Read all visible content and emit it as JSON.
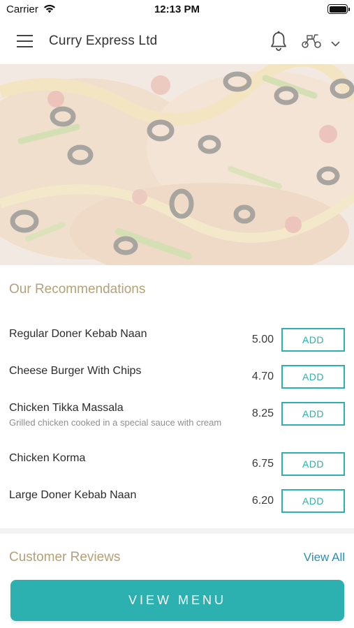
{
  "status_bar": {
    "carrier": "Carrier",
    "time": "12:13 PM"
  },
  "header": {
    "title": "Curry Express Ltd",
    "icons": [
      "menu-icon",
      "bell-icon",
      "scooter-icon",
      "chevron-down-icon"
    ]
  },
  "hero": {
    "image": "pizza-photo"
  },
  "recommendations": {
    "title": "Our Recommendations",
    "items": [
      {
        "name": "Regular Doner Kebab Naan",
        "description": "",
        "price": "5.00",
        "add_label": "ADD"
      },
      {
        "name": "Cheese Burger With Chips",
        "description": "",
        "price": "4.70",
        "add_label": "ADD"
      },
      {
        "name": "Chicken Tikka Massala",
        "description": "Grilled chicken cooked in a special sauce with cream",
        "price": "8.25",
        "add_label": "ADD"
      },
      {
        "name": "Chicken Korma",
        "description": "",
        "price": "6.75",
        "add_label": "ADD"
      },
      {
        "name": "Large Doner Kebab Naan",
        "description": "",
        "price": "6.20",
        "add_label": "ADD"
      }
    ]
  },
  "reviews": {
    "title": "Customer Reviews",
    "view_all_label": "View All"
  },
  "footer": {
    "view_menu_label": "VIEW MENU"
  },
  "colors": {
    "accent": "#2cb0b0",
    "section_title": "#b5a078",
    "link": "#2a8fb5"
  }
}
